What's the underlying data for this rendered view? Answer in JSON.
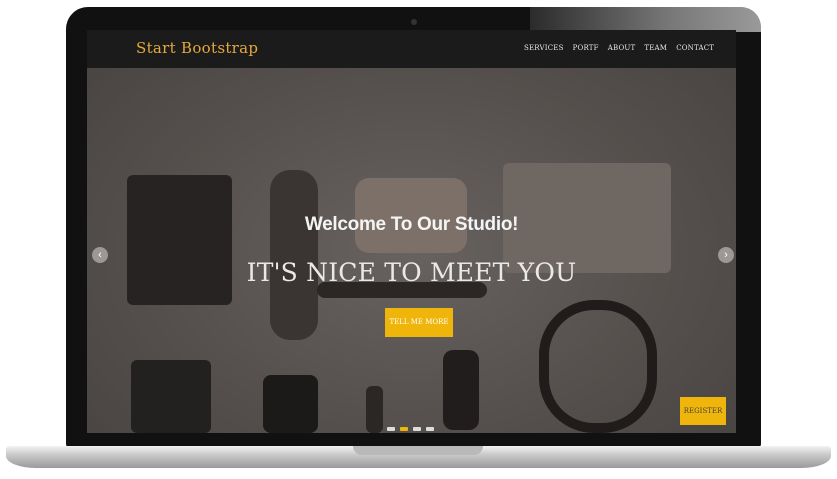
{
  "brand": "Start Bootstrap",
  "nav": {
    "items": [
      {
        "label": "SERVICES"
      },
      {
        "label": "PORTF"
      },
      {
        "label": "ABOUT"
      },
      {
        "label": "TEAM"
      },
      {
        "label": "CONTACT"
      }
    ]
  },
  "hero": {
    "subheading": "Welcome To Our Studio!",
    "heading": "IT'S NICE TO MEET YOU",
    "cta_label": "TELL ME MORE"
  },
  "carousel": {
    "prev_icon": "chevron-left-icon",
    "next_icon": "chevron-right-icon",
    "active_index": 1
  },
  "corner_button_label": "REGISTER",
  "colors": {
    "accent": "#f0b50b",
    "brand": "#e5a93c",
    "nav_bg": "#1b1b1b"
  }
}
